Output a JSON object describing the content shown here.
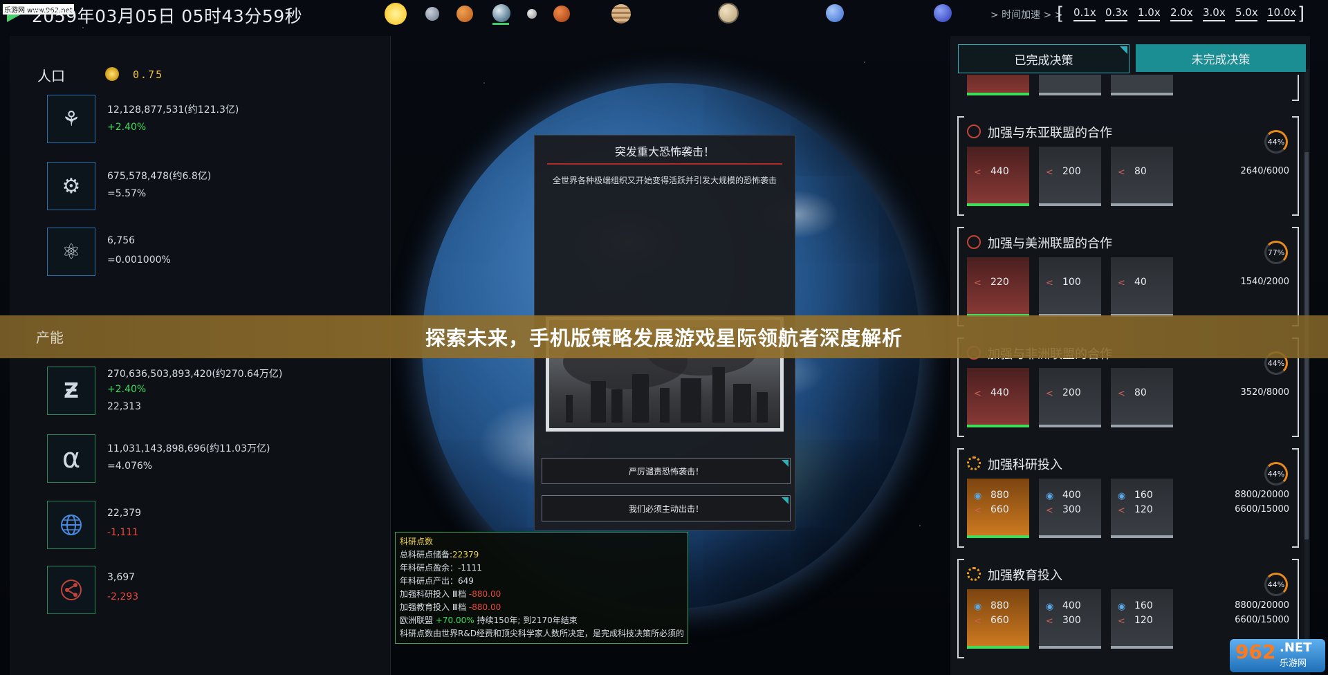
{
  "watermark_top": "乐游网 www.962.net",
  "datetime": "2059年03月05日 05时43分59秒",
  "time_speed": {
    "label": "> 时间加速 > >",
    "options": [
      "0.1x",
      "0.3x",
      "1.0x",
      "2.0x",
      "3.0x",
      "5.0x",
      "10.0x"
    ],
    "selected": "0.1x"
  },
  "planets": [
    {
      "name": "sun-icon",
      "color": "#ffd54a"
    },
    {
      "name": "mercury-icon",
      "color": "#8a96a8"
    },
    {
      "name": "venus-icon",
      "color": "#d9782a"
    },
    {
      "name": "earth-icon",
      "color": "#9ab0b8"
    },
    {
      "name": "moon-icon",
      "color": "#d0d0d0"
    },
    {
      "name": "mars-icon",
      "color": "#d9602a"
    },
    {
      "name": "jupiter-icon",
      "color": "#c8a07a"
    },
    {
      "name": "saturn-icon",
      "color": "#d8c4a0"
    },
    {
      "name": "uranus-icon",
      "color": "#6a9ae8"
    },
    {
      "name": "neptune-icon",
      "color": "#4a6ae0"
    }
  ],
  "left": {
    "population_title": "人口",
    "coin_value": "0.75",
    "population_stats": [
      {
        "icon": "population-icon",
        "line1": "12,128,877,531(约121.3亿)",
        "line2": "+2.40%",
        "line2_type": "pos"
      },
      {
        "icon": "workforce-icon",
        "line1": "675,578,478(约6.8亿)",
        "line2": "=5.57%",
        "line2_type": "neutral"
      },
      {
        "icon": "scientist-icon",
        "line1": "6,756",
        "line2": "=0.001000%",
        "line2_type": "neutral"
      }
    ],
    "production_title": "产能",
    "production_stats": [
      {
        "icon": "z-icon",
        "glyph": "Ƶ",
        "line1": "270,636,503,893,420(约270.64万亿)",
        "line2": "+2.40%",
        "line2_type": "pos",
        "line3": "22,313"
      },
      {
        "icon": "alpha-icon",
        "glyph": "α",
        "line1": "11,031,143,898,696(约11.03万亿)",
        "line2": "=4.076%",
        "line2_type": "neutral"
      },
      {
        "icon": "globe-icon",
        "glyph": "🌐",
        "line1": "22,379",
        "line2": "-1,111",
        "line2_type": "neg"
      },
      {
        "icon": "share-icon",
        "glyph": "⟨",
        "line1": "3,697",
        "line2": "-2,293",
        "line2_type": "neg"
      }
    ]
  },
  "popup": {
    "title": "突发重大恐怖袭击！",
    "text": "全世界各种极端组织又开始变得活跃并引发大规模的恐怖袭击",
    "choice1": "严厉谴责恐怖袭击！",
    "choice2": "我们必须主动出击！"
  },
  "tooltip": {
    "title": "科研点数",
    "reserve_label": "总科研点储备:",
    "reserve_value": "22379",
    "surplus": "年科研点盈余：-1111",
    "output": "年科研点产出：649",
    "research_label": "加强科研投入 Ⅲ档",
    "research_value": "-880.00",
    "education_label": "加强教育投入 Ⅲ档",
    "education_value": "-880.00",
    "eu_label": "欧洲联盟",
    "eu_value": "+70.00%",
    "eu_rest": "持续150年; 到2170年结束",
    "note": "科研点数由世界R&D经费和顶尖科学家人数所决定，是完成科技决策所必须的"
  },
  "right": {
    "tab_done": "已完成决策",
    "tab_todo": "未完成决策",
    "policies": [
      {
        "title": "加强与东亚联盟的合作",
        "icon": "cooperation-icon",
        "kind": "red",
        "levels": [
          {
            "a": "440"
          },
          {
            "a": "200"
          },
          {
            "a": "80"
          }
        ],
        "ring": "44%",
        "progress": [
          "2640/6000"
        ]
      },
      {
        "title": "加强与美洲联盟的合作",
        "icon": "cooperation-icon",
        "kind": "red",
        "levels": [
          {
            "a": "220"
          },
          {
            "a": "100"
          },
          {
            "a": "40"
          }
        ],
        "ring": "77%",
        "progress": [
          "1540/2000"
        ]
      },
      {
        "title": "加强与非洲联盟的合作",
        "icon": "cooperation-icon",
        "kind": "red",
        "levels": [
          {
            "a": "440"
          },
          {
            "a": "200"
          },
          {
            "a": "80"
          }
        ],
        "ring": "44%",
        "progress": [
          "3520/8000"
        ]
      },
      {
        "title": "加强科研投入",
        "icon": "research-gear-icon",
        "kind": "orange",
        "levels": [
          {
            "a": "880",
            "b": "660"
          },
          {
            "a": "400",
            "b": "300"
          },
          {
            "a": "160",
            "b": "120"
          }
        ],
        "ring": "44%",
        "progress": [
          "8800/20000",
          "6600/15000"
        ]
      },
      {
        "title": "加强教育投入",
        "icon": "education-gear-icon",
        "kind": "orange",
        "levels": [
          {
            "a": "880",
            "b": "660"
          },
          {
            "a": "400",
            "b": "300"
          },
          {
            "a": "160",
            "b": "120"
          }
        ],
        "ring": "44%",
        "progress": [
          "8800/20000",
          "6600/15000"
        ]
      }
    ]
  },
  "banner": "探索未来，手机版策略发展游戏星际领航者深度解析",
  "logo": {
    "num": "962",
    "net": ".NET",
    "cn": "乐游网"
  }
}
